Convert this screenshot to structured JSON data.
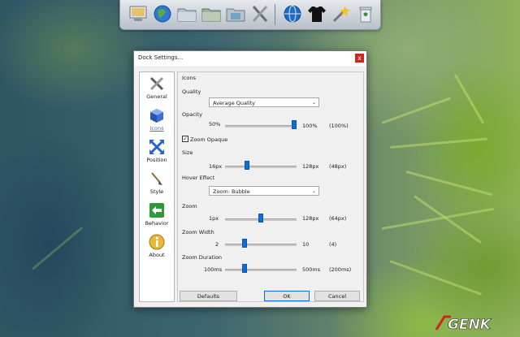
{
  "dock": {
    "items": [
      "computer-icon",
      "globe-icon",
      "folder-icon",
      "folder-icon",
      "image-folder-icon",
      "tools-icon",
      "internet-icon",
      "tshirt-icon",
      "wizard-icon",
      "recycle-bin-icon"
    ]
  },
  "dialog": {
    "title": "Dock Settings...",
    "close": "x",
    "sidebar": [
      {
        "label": "General",
        "icon": "tools-icon"
      },
      {
        "label": "Icons",
        "icon": "cube-icon"
      },
      {
        "label": "Position",
        "icon": "arrows-icon"
      },
      {
        "label": "Style",
        "icon": "brush-icon"
      },
      {
        "label": "Behavior",
        "icon": "arrow-left-icon"
      },
      {
        "label": "About",
        "icon": "info-icon"
      }
    ],
    "panel": {
      "header": "Icons",
      "quality": {
        "label": "Quality",
        "value": "Average Quality"
      },
      "opacity": {
        "label": "Opacity",
        "min": "50%",
        "max": "100%",
        "current": "(100%)",
        "level": 1.0
      },
      "zoom_opaque": {
        "label": "Zoom Opaque",
        "checked": true,
        "mark": "✓"
      },
      "size": {
        "label": "Size",
        "min": "16px",
        "max": "128px",
        "current": "(48px)",
        "level": 0.29
      },
      "hover_effect": {
        "label": "Hover Effect",
        "value": "Zoom: Bubble"
      },
      "zoom": {
        "label": "Zoom",
        "min": "1px",
        "max": "128px",
        "current": "(64px)",
        "level": 0.5
      },
      "zoom_width": {
        "label": "Zoom Width",
        "min": "2",
        "max": "10",
        "current": "(4)",
        "level": 0.25
      },
      "zoom_duration": {
        "label": "Zoom Duration",
        "min": "100ms",
        "max": "500ms",
        "current": "(200ms)",
        "level": 0.25
      }
    },
    "buttons": {
      "defaults": "Defaults",
      "ok": "OK",
      "cancel": "Cancel"
    }
  },
  "watermark": "GENK",
  "colors": {
    "accent": "#0b6ed6",
    "close": "#c42b1c"
  }
}
